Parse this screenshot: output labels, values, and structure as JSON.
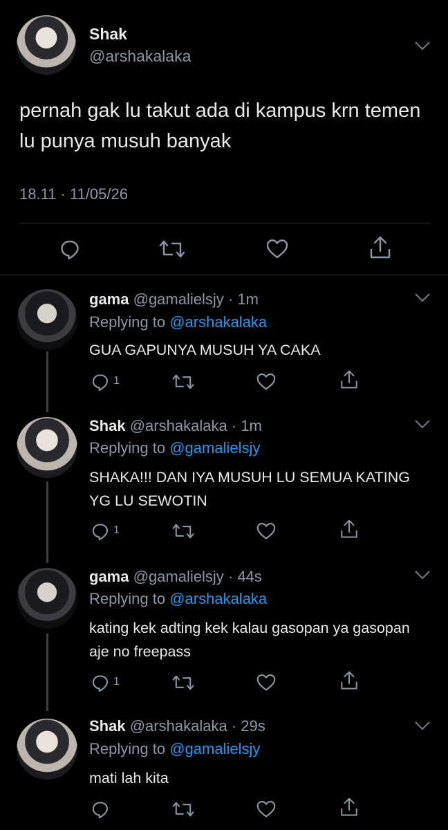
{
  "main": {
    "author_name": "Shak",
    "author_handle": "@arshakalaka",
    "text": "pernah gak lu takut ada di kampus krn temen lu punya musuh banyak",
    "timestamp": "18.11 · 11/05/26"
  },
  "replies": [
    {
      "name": "gama",
      "handle": "@gamalielsjy",
      "time": "· 1m",
      "replying_label": "Replying to",
      "replying_to": "@arshakalaka",
      "text": "GUA GAPUNYA MUSUH YA CAKA",
      "reply_count": "1"
    },
    {
      "name": "Shak",
      "handle": "@arshakalaka",
      "time": "· 1m",
      "replying_label": "Replying to",
      "replying_to": "@gamalielsjy",
      "text": "SHAKA!!! DAN IYA MUSUH LU SEMUA KATING YG LU SEWOTIN",
      "reply_count": "1"
    },
    {
      "name": "gama",
      "handle": "@gamalielsjy",
      "time": "· 44s",
      "replying_label": "Replying to",
      "replying_to": "@arshakalaka",
      "text": "kating kek adting kek kalau gasopan ya gasopan aje no freepass",
      "reply_count": "1"
    },
    {
      "name": "Shak",
      "handle": "@arshakalaka",
      "time": "· 29s",
      "replying_label": "Replying to",
      "replying_to": "@gamalielsjy",
      "text": "mati lah kita",
      "reply_count": ""
    }
  ],
  "icons": [
    "reply-icon",
    "retweet-icon",
    "like-icon",
    "share-icon",
    "chevron-down-icon"
  ],
  "colors": {
    "background": "#000000",
    "text": "#e7e9ea",
    "muted": "#8b98a5",
    "link": "#1d9bf0",
    "divider": "#2f3336"
  }
}
